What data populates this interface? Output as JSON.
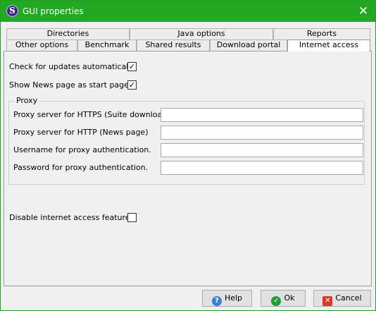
{
  "window": {
    "title": "GUI properties",
    "app_icon_letter": "S",
    "close_glyph": "✕"
  },
  "tabs": {
    "row1": [
      "Directories",
      "Java options",
      "Reports"
    ],
    "row2": [
      "Other options",
      "Benchmark",
      "Shared results",
      "Download portal",
      "Internet access"
    ],
    "active": "Internet access"
  },
  "panel": {
    "check_updates_label": "Check for updates automatically",
    "check_updates_checked": true,
    "news_start_label": "Show News page as start page",
    "news_start_checked": true,
    "proxy": {
      "title": "Proxy",
      "https_label": "Proxy server for HTTPS (Suite download)",
      "https_value": "",
      "http_label": "Proxy server for HTTP (News page)",
      "http_value": "",
      "username_label": "Username for proxy authentication.",
      "username_value": "",
      "password_label": "Password for proxy authentication.",
      "password_value": ""
    },
    "disable_label": "Disable internet access features",
    "disable_checked": false
  },
  "buttons": {
    "help": "Help",
    "ok": "Ok",
    "cancel": "Cancel"
  },
  "glyphs": {
    "check": "✓"
  },
  "colors": {
    "titlebar": "#22a822",
    "border": "#1f9e1f"
  }
}
